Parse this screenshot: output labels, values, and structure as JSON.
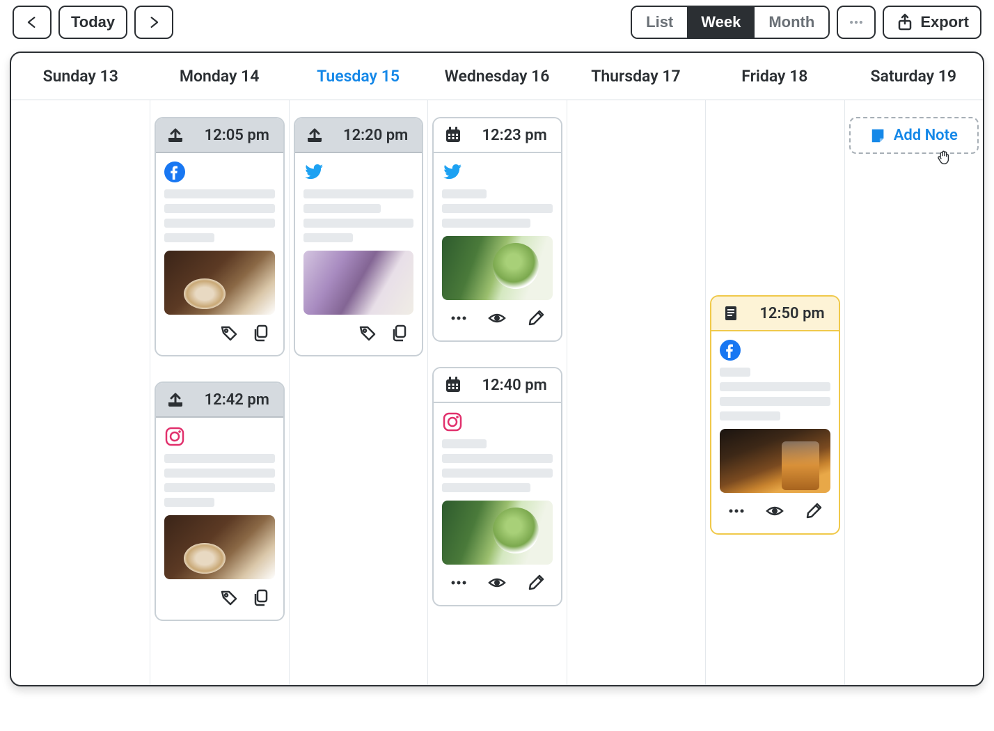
{
  "toolbar": {
    "today_label": "Today",
    "view_list": "List",
    "view_week": "Week",
    "view_month": "Month",
    "export_label": "Export",
    "active_view": "week"
  },
  "days": [
    {
      "label": "Sunday 13",
      "today": false
    },
    {
      "label": "Monday 14",
      "today": false
    },
    {
      "label": "Tuesday 15",
      "today": true
    },
    {
      "label": "Wednesday 16",
      "today": false
    },
    {
      "label": "Thursday 17",
      "today": false
    },
    {
      "label": "Friday 18",
      "today": false
    },
    {
      "label": "Saturday 19",
      "today": false
    }
  ],
  "posts": {
    "mon": [
      {
        "time": "12:05 pm",
        "status": "sent",
        "platform": "facebook",
        "head_icon": "upload",
        "thumb": "coffee",
        "actions": [
          "tag",
          "copy"
        ],
        "lines": [
          100,
          100,
          100,
          45
        ]
      },
      {
        "time": "12:42 pm",
        "status": "sent",
        "platform": "instagram",
        "head_icon": "upload",
        "thumb": "coffee",
        "actions": [
          "tag",
          "copy"
        ],
        "lines": [
          100,
          100,
          100,
          45
        ]
      }
    ],
    "tue": [
      {
        "time": "12:20 pm",
        "status": "sent",
        "platform": "twitter",
        "head_icon": "upload",
        "thumb": "lilac",
        "actions": [
          "tag",
          "copy"
        ],
        "lines": [
          100,
          70,
          100,
          45
        ]
      }
    ],
    "wed": [
      {
        "time": "12:23 pm",
        "status": "scheduled",
        "platform": "twitter",
        "head_icon": "calendar",
        "thumb": "matcha",
        "actions": [
          "more",
          "eye",
          "edit"
        ],
        "lines": [
          40,
          100,
          80
        ]
      },
      {
        "time": "12:40 pm",
        "status": "scheduled",
        "platform": "instagram",
        "head_icon": "calendar",
        "thumb": "matcha",
        "actions": [
          "more",
          "eye",
          "edit"
        ],
        "lines": [
          40,
          100,
          100,
          80
        ]
      }
    ],
    "fri": [
      {
        "time": "12:50 pm",
        "status": "draft",
        "platform": "facebook",
        "head_icon": "note",
        "thumb": "whiskey",
        "actions": [
          "more",
          "eye",
          "edit"
        ],
        "lines": [
          28,
          100,
          100,
          55
        ]
      }
    ]
  },
  "addnote_label": "Add Note",
  "colors": {
    "brand_blue": "#1588e8",
    "dark": "#2b2f33"
  }
}
